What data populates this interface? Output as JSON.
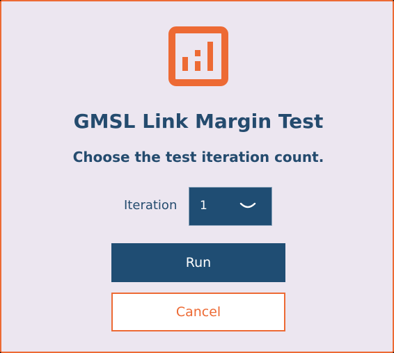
{
  "dialog": {
    "icon": "bar-chart-icon",
    "title": "GMSL Link Margin Test",
    "subtitle": "Choose the test iteration count.",
    "iteration": {
      "label": "Iteration",
      "value": "1",
      "icon": "chevron-down-icon"
    },
    "buttons": {
      "run": "Run",
      "cancel": "Cancel"
    }
  },
  "colors": {
    "accent": "#ed6a34",
    "primary": "#1f4d73",
    "text": "#244b6e",
    "background": "#ece6f0"
  }
}
